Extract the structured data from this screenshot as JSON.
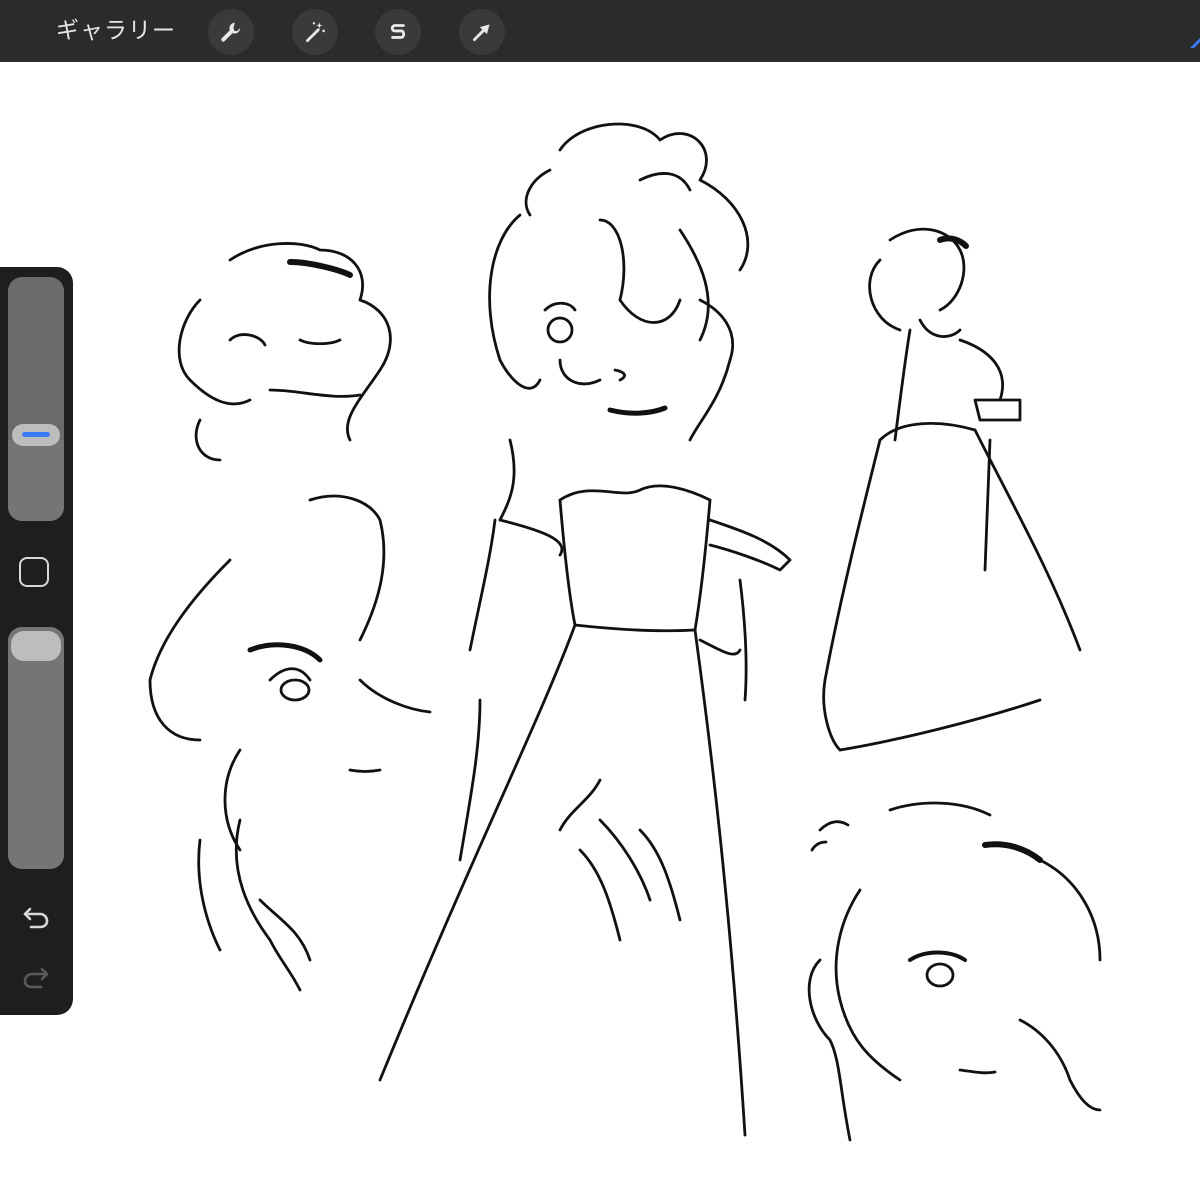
{
  "toolbar": {
    "gallery_label": "ギャラリー",
    "tools": [
      {
        "name": "actions",
        "icon": "wrench-icon"
      },
      {
        "name": "adjustments",
        "icon": "magic-wand-icon"
      },
      {
        "name": "selection",
        "icon": "selection-s-icon"
      },
      {
        "name": "transform",
        "icon": "arrow-cursor-icon"
      }
    ],
    "brush_accent_color": "#3b7cff"
  },
  "sidebar": {
    "brush_size": 0.33,
    "brush_opacity": 1.0,
    "modify_icon": "square-icon",
    "undo_icon": "undo-arrow-icon",
    "redo_icon": "redo-arrow-icon",
    "accent_color": "#3b7cff"
  },
  "canvas": {
    "content": "sketch",
    "stroke_color": "#111111",
    "background_color": "#ffffff"
  }
}
